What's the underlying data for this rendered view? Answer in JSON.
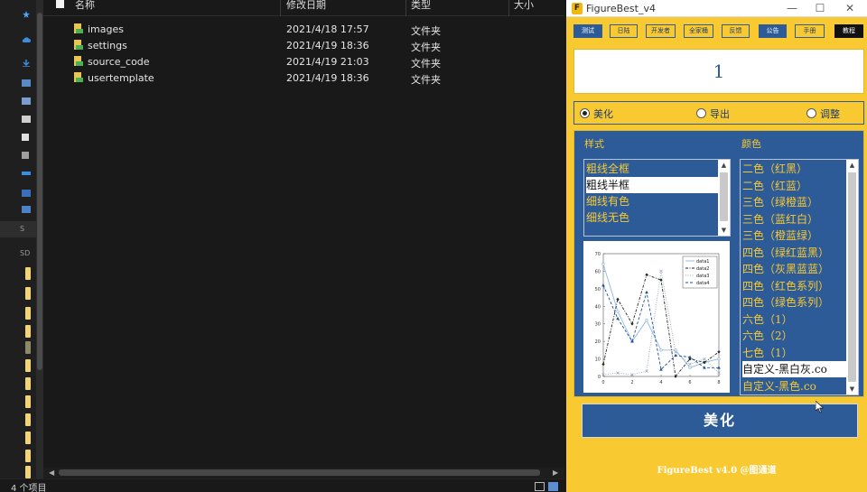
{
  "explorer": {
    "columns": [
      "名称",
      "修改日期",
      "类型",
      "大小"
    ],
    "rows": [
      {
        "name": "images",
        "date": "2021/4/18 17:57",
        "type": "文件夹"
      },
      {
        "name": "settings",
        "date": "2021/4/19 18:36",
        "type": "文件夹"
      },
      {
        "name": "source_code",
        "date": "2021/4/19 21:03",
        "type": "文件夹"
      },
      {
        "name": "usertemplate",
        "date": "2021/4/19 18:36",
        "type": "文件夹"
      }
    ],
    "status": "4 个项目",
    "nav_text": [
      "S",
      "SD"
    ]
  },
  "app": {
    "title": "FigureBest_v4",
    "logo_char": "F",
    "toolbar": [
      "测试",
      "日陆",
      "开发者",
      "全家桶",
      "反馈",
      "公告",
      "手册",
      "教程"
    ],
    "counter": "1",
    "modes": [
      {
        "label": "美化",
        "checked": true
      },
      {
        "label": "导出",
        "checked": false
      },
      {
        "label": "调整",
        "checked": false
      }
    ],
    "style_header": "样式",
    "color_header": "颜色",
    "styles": [
      "粗线全框",
      "粗线半框",
      "细线有色",
      "细线无色"
    ],
    "selected_style_index": 1,
    "colors": [
      "二色（红黑）",
      "二色（红蓝）",
      "三色（绿橙蓝）",
      "三色（蓝红白）",
      "三色（橙蓝绿）",
      "四色（绿红蓝黑）",
      "四色（灰黑蓝蓝）",
      "四色（红色系列）",
      "四色（绿色系列）",
      "六色（1）",
      "六色（2）",
      "七色（1）",
      "自定义-黑白灰.co",
      "自定义-黑色.co"
    ],
    "selected_color_index": 12,
    "beautify_button": "美化",
    "footer": "FigureBest v4.0 @图通道",
    "colors_theme": {
      "yellow": "#f9c932",
      "blue": "#2c5b98"
    }
  },
  "chart_data": {
    "type": "line",
    "x": [
      0,
      1,
      2,
      3,
      4,
      5,
      6,
      7,
      8
    ],
    "series": [
      {
        "name": "data1",
        "values": [
          64,
          37,
          20,
          32,
          15,
          15,
          5,
          8,
          10
        ],
        "color": "#8fb8e4",
        "style": "solid",
        "marker": "o"
      },
      {
        "name": "data2",
        "values": [
          7,
          44,
          30,
          58,
          55,
          0,
          10,
          8,
          14
        ],
        "color": "#222222",
        "style": "dashdot",
        "marker": "d"
      },
      {
        "name": "data3",
        "values": [
          1,
          2,
          1,
          3,
          60,
          14,
          7,
          10,
          2
        ],
        "color": "#9aa9bd",
        "style": "dotted",
        "marker": "x"
      },
      {
        "name": "data4",
        "values": [
          52,
          33,
          20,
          48,
          4,
          12,
          11,
          5,
          5
        ],
        "color": "#1f4f9a",
        "style": "dashed",
        "marker": "^"
      }
    ],
    "xticks": [
      "0",
      "2",
      "4",
      "6",
      "8"
    ],
    "yticks": [
      "0",
      "10",
      "20",
      "30",
      "40",
      "50",
      "60",
      "70"
    ],
    "xlim": [
      0,
      8
    ],
    "ylim": [
      0,
      70
    ],
    "legend_placement": "top-right"
  }
}
